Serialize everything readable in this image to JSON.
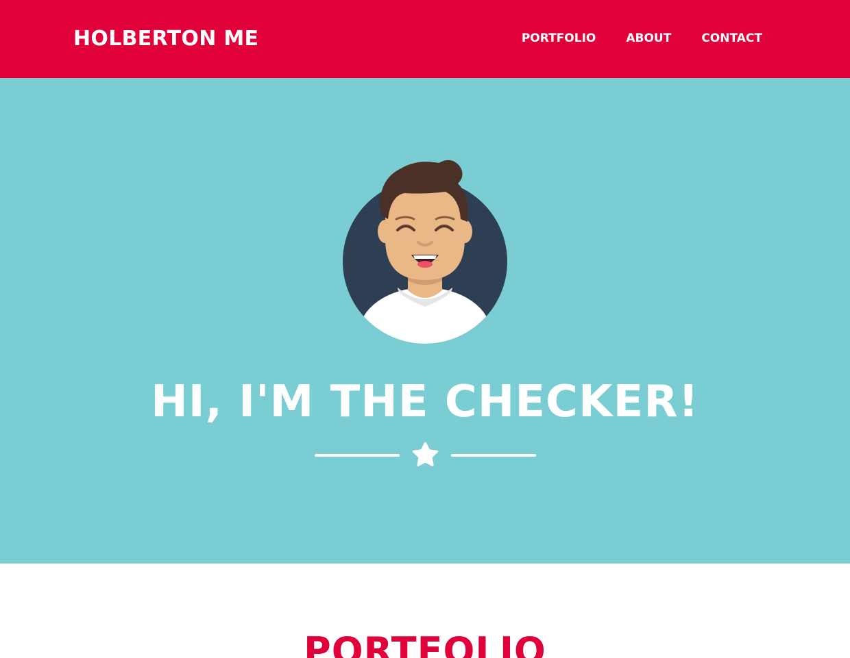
{
  "header": {
    "brand": "HOLBERTON ME",
    "nav": [
      {
        "label": "PORTFOLIO"
      },
      {
        "label": "ABOUT"
      },
      {
        "label": "CONTACT"
      }
    ]
  },
  "hero": {
    "headline": "HI, I'M THE CHECKER!",
    "avatar_icon": "smiling-man-avatar-icon",
    "divider_icon": "star-icon"
  },
  "portfolio": {
    "title": "PORTFOLIO"
  },
  "colors": {
    "header_bg": "#e0003a",
    "hero_bg": "#7acdd2",
    "text_light": "#ffffff",
    "accent": "#e0003a"
  }
}
